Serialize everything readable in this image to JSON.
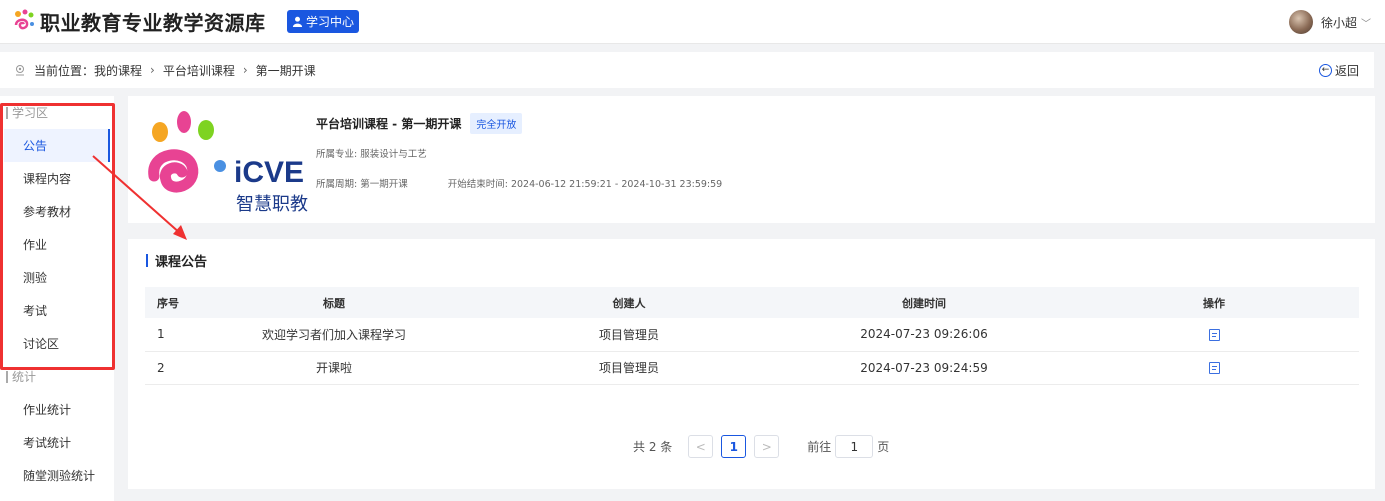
{
  "header": {
    "site_title": "职业教育专业教学资源库",
    "study_center": "学习中心",
    "user_name": "徐小超"
  },
  "breadcrumb": {
    "prefix": "当前位置：",
    "items": [
      "我的课程",
      "平台培训课程",
      "第一期开课"
    ],
    "back": "返回"
  },
  "sidebar": {
    "sections": [
      {
        "title": "学习区",
        "items": [
          "公告",
          "课程内容",
          "参考教材",
          "作业",
          "测验",
          "考试",
          "讨论区"
        ]
      },
      {
        "title": "统计",
        "items": [
          "作业统计",
          "考试统计",
          "随堂测验统计"
        ]
      }
    ],
    "active_item": "公告"
  },
  "course": {
    "logo_text": "iCVE",
    "logo_sub": "智慧职教",
    "title": "平台培训课程 - 第一期开课",
    "tag": "完全开放",
    "major": "所属专业: 服装设计与工艺",
    "period": "所属周期: 第一期开课",
    "time_range": "开始结束时间: 2024-06-12 21:59:21 - 2024-10-31 23:59:59"
  },
  "announcements": {
    "title": "课程公告",
    "columns": [
      "序号",
      "标题",
      "创建人",
      "创建时间",
      "操作"
    ],
    "rows": [
      {
        "no": "1",
        "title": "欢迎学习者们加入课程学习",
        "creator": "项目管理员",
        "time": "2024-07-23 09:26:06"
      },
      {
        "no": "2",
        "title": "开课啦",
        "creator": "项目管理员",
        "time": "2024-07-23 09:24:59"
      }
    ]
  },
  "pagination": {
    "total": "共 2 条",
    "prev": "<",
    "current": "1",
    "next": ">",
    "goto": "前往",
    "page_value": "1",
    "page_unit": "页"
  },
  "colors": {
    "accent": "#1a57e0",
    "highlight": "#ef3131"
  }
}
